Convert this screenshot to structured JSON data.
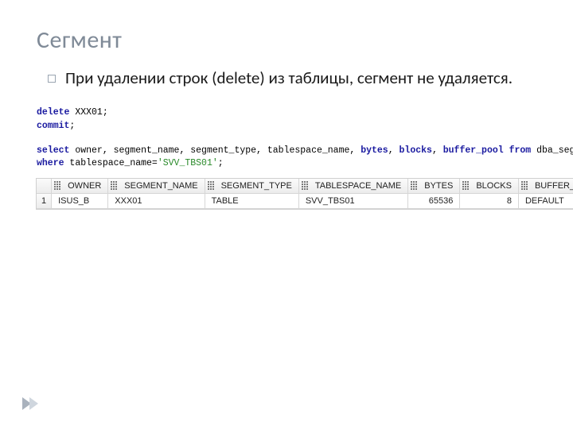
{
  "title": "Сегмент",
  "bullet": "При удалении строк (delete) из таблицы, сегмент не удаляется.",
  "code": {
    "line1_kw": "delete",
    "line1_rest": " XXX01;",
    "line2_kw": "commit",
    "line2_rest": ";",
    "line3_kw1": "select",
    "line3_mid1": " owner, segment_name, segment_type, tablespace_name, ",
    "line3_kw2": "bytes",
    "line3_mid2": ", ",
    "line3_kw3": "blocks",
    "line3_mid3": ", ",
    "line3_kw4": "buffer_pool",
    "line3_mid4": "  ",
    "line3_kw5": "from",
    "line3_rest": " dba_segments",
    "line4_kw": "where",
    "line4_mid": " tablespace_name=",
    "line4_str": "'SVV_TBS01'",
    "line4_rest": ";"
  },
  "table": {
    "headers": [
      "OWNER",
      "SEGMENT_NAME",
      "SEGMENT_TYPE",
      "TABLESPACE_NAME",
      "BYTES",
      "BLOCKS",
      "BUFFER_POOL"
    ],
    "rows": [
      {
        "n": "1",
        "owner": "ISUS_B",
        "segment_name": "XXX01",
        "segment_type": "TABLE",
        "tablespace_name": "SVV_TBS01",
        "bytes": "65536",
        "blocks": "8",
        "buffer_pool": "DEFAULT"
      }
    ]
  }
}
